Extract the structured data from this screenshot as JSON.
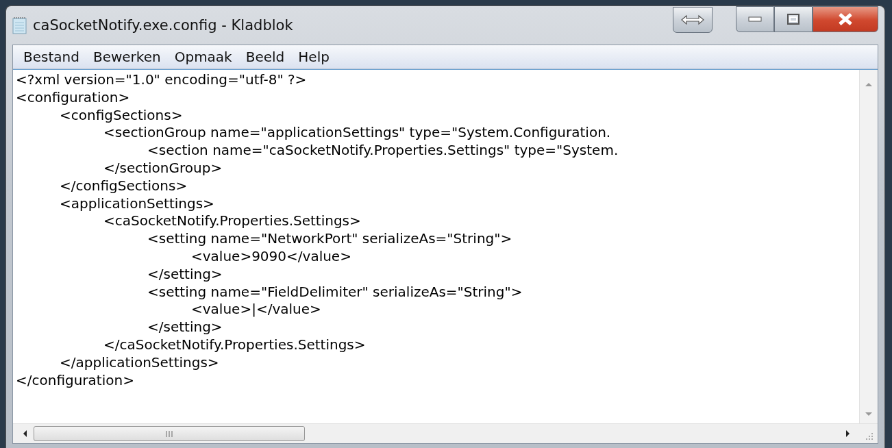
{
  "window": {
    "title": "caSocketNotify.exe.config - Kladblok"
  },
  "menu": [
    "Bestand",
    "Bewerken",
    "Opmaak",
    "Beeld",
    "Help"
  ],
  "editor": {
    "lines": [
      "<?xml version=\"1.0\" encoding=\"utf-8\" ?>",
      "<configuration>",
      "\t<configSections>",
      "\t\t<sectionGroup name=\"applicationSettings\" type=\"System.Configuration.",
      "\t\t\t<section name=\"caSocketNotify.Properties.Settings\" type=\"System.",
      "\t\t</sectionGroup>",
      "\t</configSections>",
      "\t<applicationSettings>",
      "\t\t<caSocketNotify.Properties.Settings>",
      "\t\t\t<setting name=\"NetworkPort\" serializeAs=\"String\">",
      "\t\t\t\t<value>9090</value>",
      "\t\t\t</setting>",
      "\t\t\t<setting name=\"FieldDelimiter\" serializeAs=\"String\">",
      "\t\t\t\t<value>|</value>",
      "\t\t\t</setting>",
      "\t\t</caSocketNotify.Properties.Settings>",
      "\t</applicationSettings>",
      "</configuration>"
    ]
  }
}
